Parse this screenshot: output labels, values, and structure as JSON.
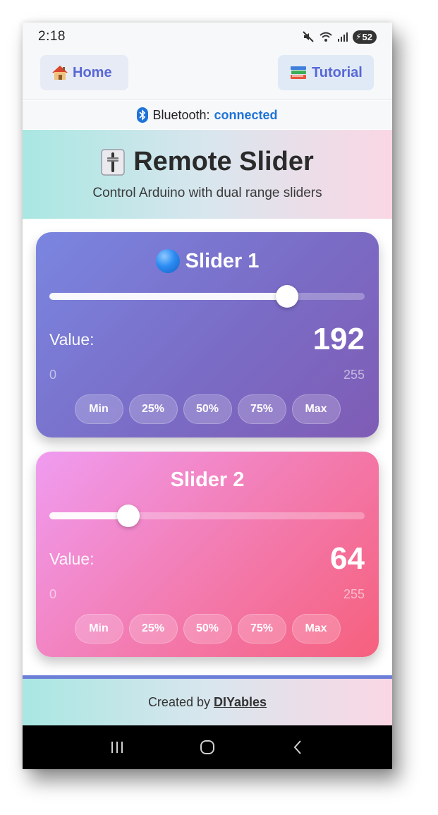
{
  "status_bar": {
    "time": "2:18",
    "battery": "52"
  },
  "nav": {
    "home_label": "Home",
    "tutorial_label": "Tutorial"
  },
  "bluetooth": {
    "label": "Bluetooth:",
    "status": "connected"
  },
  "hero": {
    "title": "Remote Slider",
    "subtitle": "Control Arduino with dual range sliders"
  },
  "sliders": [
    {
      "title": "Slider 1",
      "value_label": "Value:",
      "value": "192",
      "min": "0",
      "max": "255",
      "fraction": 0.753,
      "presets": [
        "Min",
        "25%",
        "50%",
        "75%",
        "Max"
      ]
    },
    {
      "title": "Slider 2",
      "value_label": "Value:",
      "value": "64",
      "min": "0",
      "max": "255",
      "fraction": 0.251,
      "presets": [
        "Min",
        "25%",
        "50%",
        "75%",
        "Max"
      ]
    }
  ],
  "footer": {
    "prefix": "Created by",
    "link": "DIYables"
  },
  "icons": {
    "home": "house-icon",
    "tutorial": "books-icon",
    "bluetooth": "bluetooth-icon",
    "hero": "level-slider-icon",
    "slider1": "blue-circle-icon",
    "mute": "mute-icon",
    "wifi": "wifi-icon",
    "signal": "signal-icon",
    "nav_recents": "recents-icon",
    "nav_home": "home-circle-icon",
    "nav_back": "back-icon"
  },
  "colors": {
    "accent": "#5867d6",
    "bluetooth": "#1e73d8",
    "card1": "#7a6cc6",
    "card2": "#f37aae"
  }
}
